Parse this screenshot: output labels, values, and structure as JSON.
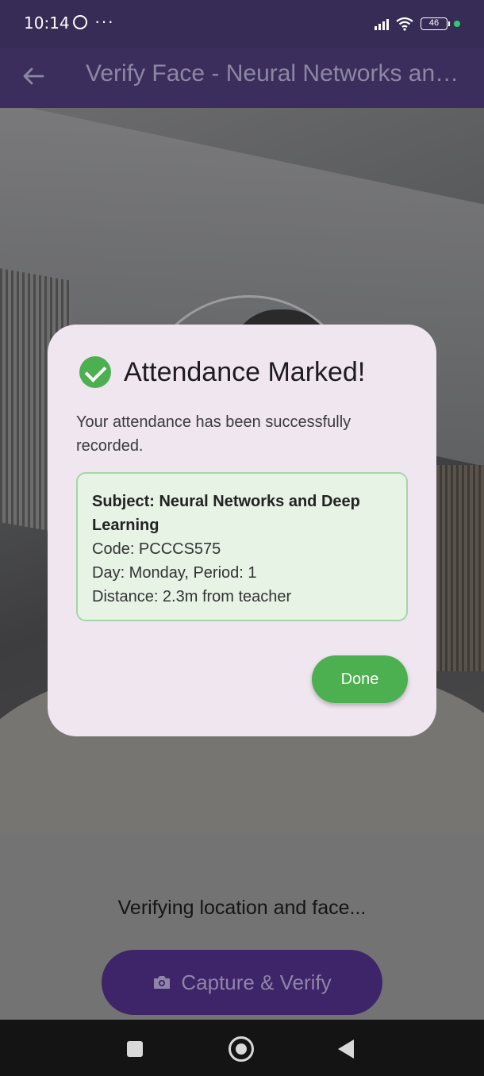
{
  "status_bar": {
    "time": "10:14",
    "more": "···",
    "battery": "46"
  },
  "app_bar": {
    "title": "Verify Face - Neural Networks and Deep Learning"
  },
  "main": {
    "status_text": "Verifying location and face...",
    "capture_label": "Capture & Verify"
  },
  "dialog": {
    "title": "Attendance Marked!",
    "message": "Your attendance has been successfully recorded.",
    "subject": "Subject: Neural Networks and Deep Learning",
    "code": "Code: PCCCS575",
    "day_period": "Day: Monday, Period: 1",
    "distance": "Distance: 2.3m from teacher",
    "done_label": "Done"
  },
  "colors": {
    "app_bar": "#3b2e5c",
    "accent_green": "#4caf50",
    "capture_button": "#3e2468"
  }
}
